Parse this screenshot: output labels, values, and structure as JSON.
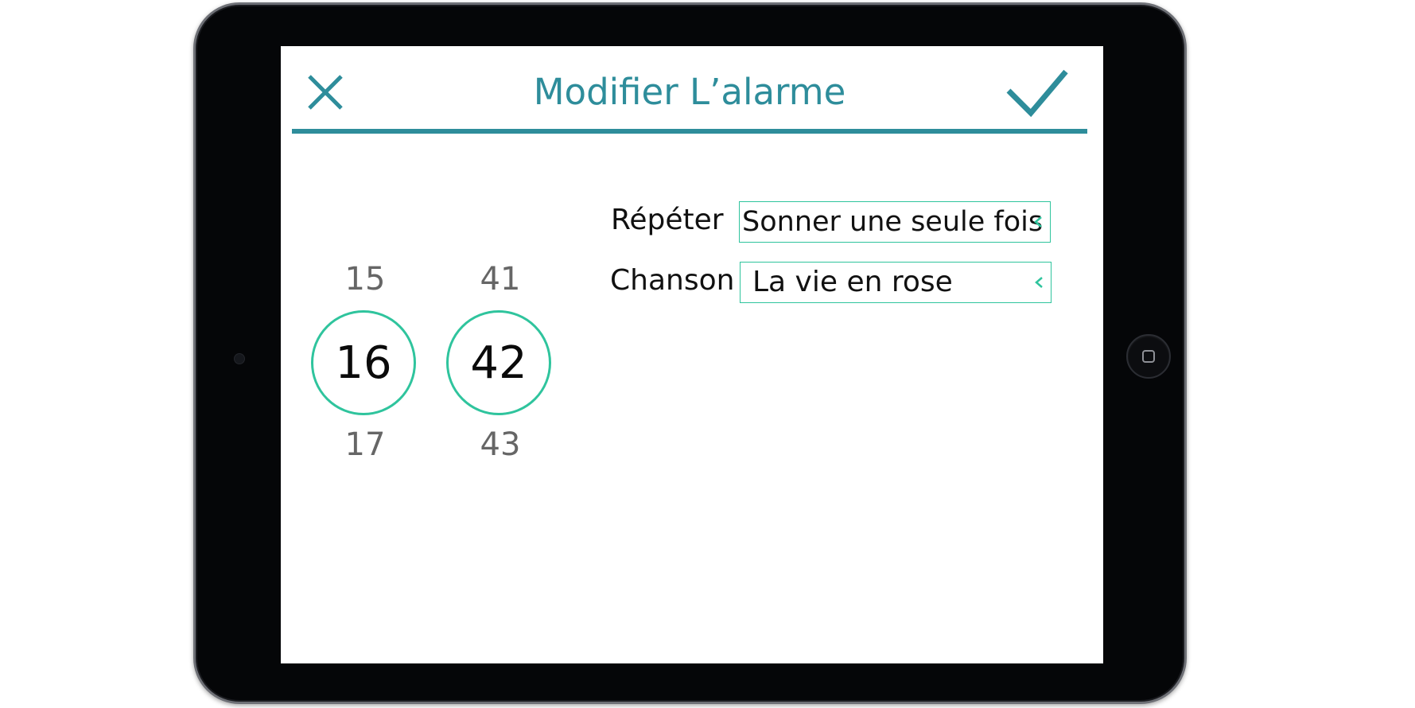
{
  "header": {
    "title": "Modifier L’alarme",
    "close_icon": "close-icon",
    "confirm_icon": "check-icon"
  },
  "time_picker": {
    "hours": {
      "previous": "15",
      "selected": "16",
      "next": "17"
    },
    "minutes": {
      "previous": "41",
      "selected": "42",
      "next": "43"
    }
  },
  "settings": {
    "repeat": {
      "label": "Répéter",
      "value": "Sonner une seule fois"
    },
    "song": {
      "label": "Chanson",
      "value": "La vie en rose"
    }
  },
  "colors": {
    "accent": "#2e8d9b",
    "highlight": "#2fc49d",
    "device_frame": "#050608"
  }
}
